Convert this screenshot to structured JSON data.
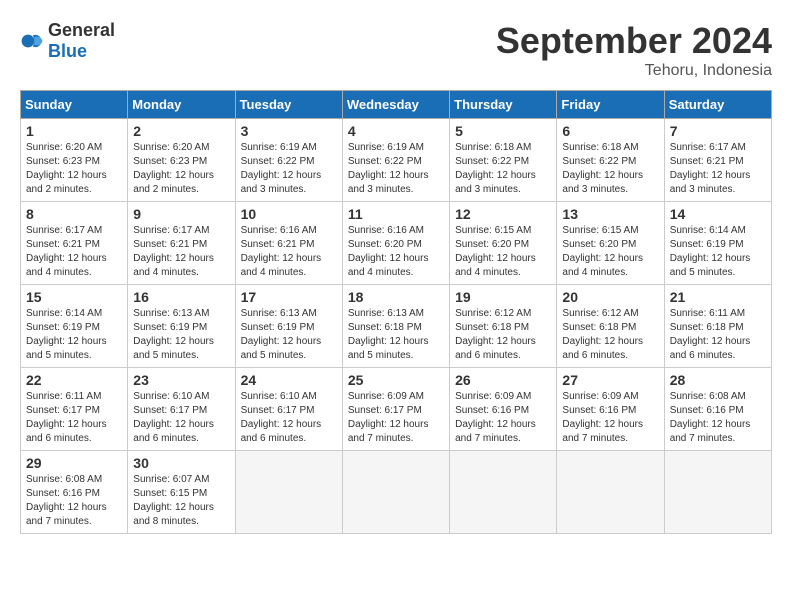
{
  "logo": {
    "general": "General",
    "blue": "Blue"
  },
  "title": "September 2024",
  "location": "Tehoru, Indonesia",
  "days": [
    "Sunday",
    "Monday",
    "Tuesday",
    "Wednesday",
    "Thursday",
    "Friday",
    "Saturday"
  ],
  "weeks": [
    [
      {
        "day": "1",
        "sunrise": "6:20 AM",
        "sunset": "6:23 PM",
        "daylight": "12 hours and 2 minutes."
      },
      {
        "day": "2",
        "sunrise": "6:20 AM",
        "sunset": "6:23 PM",
        "daylight": "12 hours and 2 minutes."
      },
      {
        "day": "3",
        "sunrise": "6:19 AM",
        "sunset": "6:22 PM",
        "daylight": "12 hours and 3 minutes."
      },
      {
        "day": "4",
        "sunrise": "6:19 AM",
        "sunset": "6:22 PM",
        "daylight": "12 hours and 3 minutes."
      },
      {
        "day": "5",
        "sunrise": "6:18 AM",
        "sunset": "6:22 PM",
        "daylight": "12 hours and 3 minutes."
      },
      {
        "day": "6",
        "sunrise": "6:18 AM",
        "sunset": "6:22 PM",
        "daylight": "12 hours and 3 minutes."
      },
      {
        "day": "7",
        "sunrise": "6:17 AM",
        "sunset": "6:21 PM",
        "daylight": "12 hours and 3 minutes."
      }
    ],
    [
      {
        "day": "8",
        "sunrise": "6:17 AM",
        "sunset": "6:21 PM",
        "daylight": "12 hours and 4 minutes."
      },
      {
        "day": "9",
        "sunrise": "6:17 AM",
        "sunset": "6:21 PM",
        "daylight": "12 hours and 4 minutes."
      },
      {
        "day": "10",
        "sunrise": "6:16 AM",
        "sunset": "6:21 PM",
        "daylight": "12 hours and 4 minutes."
      },
      {
        "day": "11",
        "sunrise": "6:16 AM",
        "sunset": "6:20 PM",
        "daylight": "12 hours and 4 minutes."
      },
      {
        "day": "12",
        "sunrise": "6:15 AM",
        "sunset": "6:20 PM",
        "daylight": "12 hours and 4 minutes."
      },
      {
        "day": "13",
        "sunrise": "6:15 AM",
        "sunset": "6:20 PM",
        "daylight": "12 hours and 4 minutes."
      },
      {
        "day": "14",
        "sunrise": "6:14 AM",
        "sunset": "6:19 PM",
        "daylight": "12 hours and 5 minutes."
      }
    ],
    [
      {
        "day": "15",
        "sunrise": "6:14 AM",
        "sunset": "6:19 PM",
        "daylight": "12 hours and 5 minutes."
      },
      {
        "day": "16",
        "sunrise": "6:13 AM",
        "sunset": "6:19 PM",
        "daylight": "12 hours and 5 minutes."
      },
      {
        "day": "17",
        "sunrise": "6:13 AM",
        "sunset": "6:19 PM",
        "daylight": "12 hours and 5 minutes."
      },
      {
        "day": "18",
        "sunrise": "6:13 AM",
        "sunset": "6:18 PM",
        "daylight": "12 hours and 5 minutes."
      },
      {
        "day": "19",
        "sunrise": "6:12 AM",
        "sunset": "6:18 PM",
        "daylight": "12 hours and 6 minutes."
      },
      {
        "day": "20",
        "sunrise": "6:12 AM",
        "sunset": "6:18 PM",
        "daylight": "12 hours and 6 minutes."
      },
      {
        "day": "21",
        "sunrise": "6:11 AM",
        "sunset": "6:18 PM",
        "daylight": "12 hours and 6 minutes."
      }
    ],
    [
      {
        "day": "22",
        "sunrise": "6:11 AM",
        "sunset": "6:17 PM",
        "daylight": "12 hours and 6 minutes."
      },
      {
        "day": "23",
        "sunrise": "6:10 AM",
        "sunset": "6:17 PM",
        "daylight": "12 hours and 6 minutes."
      },
      {
        "day": "24",
        "sunrise": "6:10 AM",
        "sunset": "6:17 PM",
        "daylight": "12 hours and 6 minutes."
      },
      {
        "day": "25",
        "sunrise": "6:09 AM",
        "sunset": "6:17 PM",
        "daylight": "12 hours and 7 minutes."
      },
      {
        "day": "26",
        "sunrise": "6:09 AM",
        "sunset": "6:16 PM",
        "daylight": "12 hours and 7 minutes."
      },
      {
        "day": "27",
        "sunrise": "6:09 AM",
        "sunset": "6:16 PM",
        "daylight": "12 hours and 7 minutes."
      },
      {
        "day": "28",
        "sunrise": "6:08 AM",
        "sunset": "6:16 PM",
        "daylight": "12 hours and 7 minutes."
      }
    ],
    [
      {
        "day": "29",
        "sunrise": "6:08 AM",
        "sunset": "6:16 PM",
        "daylight": "12 hours and 7 minutes."
      },
      {
        "day": "30",
        "sunrise": "6:07 AM",
        "sunset": "6:15 PM",
        "daylight": "12 hours and 8 minutes."
      },
      null,
      null,
      null,
      null,
      null
    ]
  ]
}
